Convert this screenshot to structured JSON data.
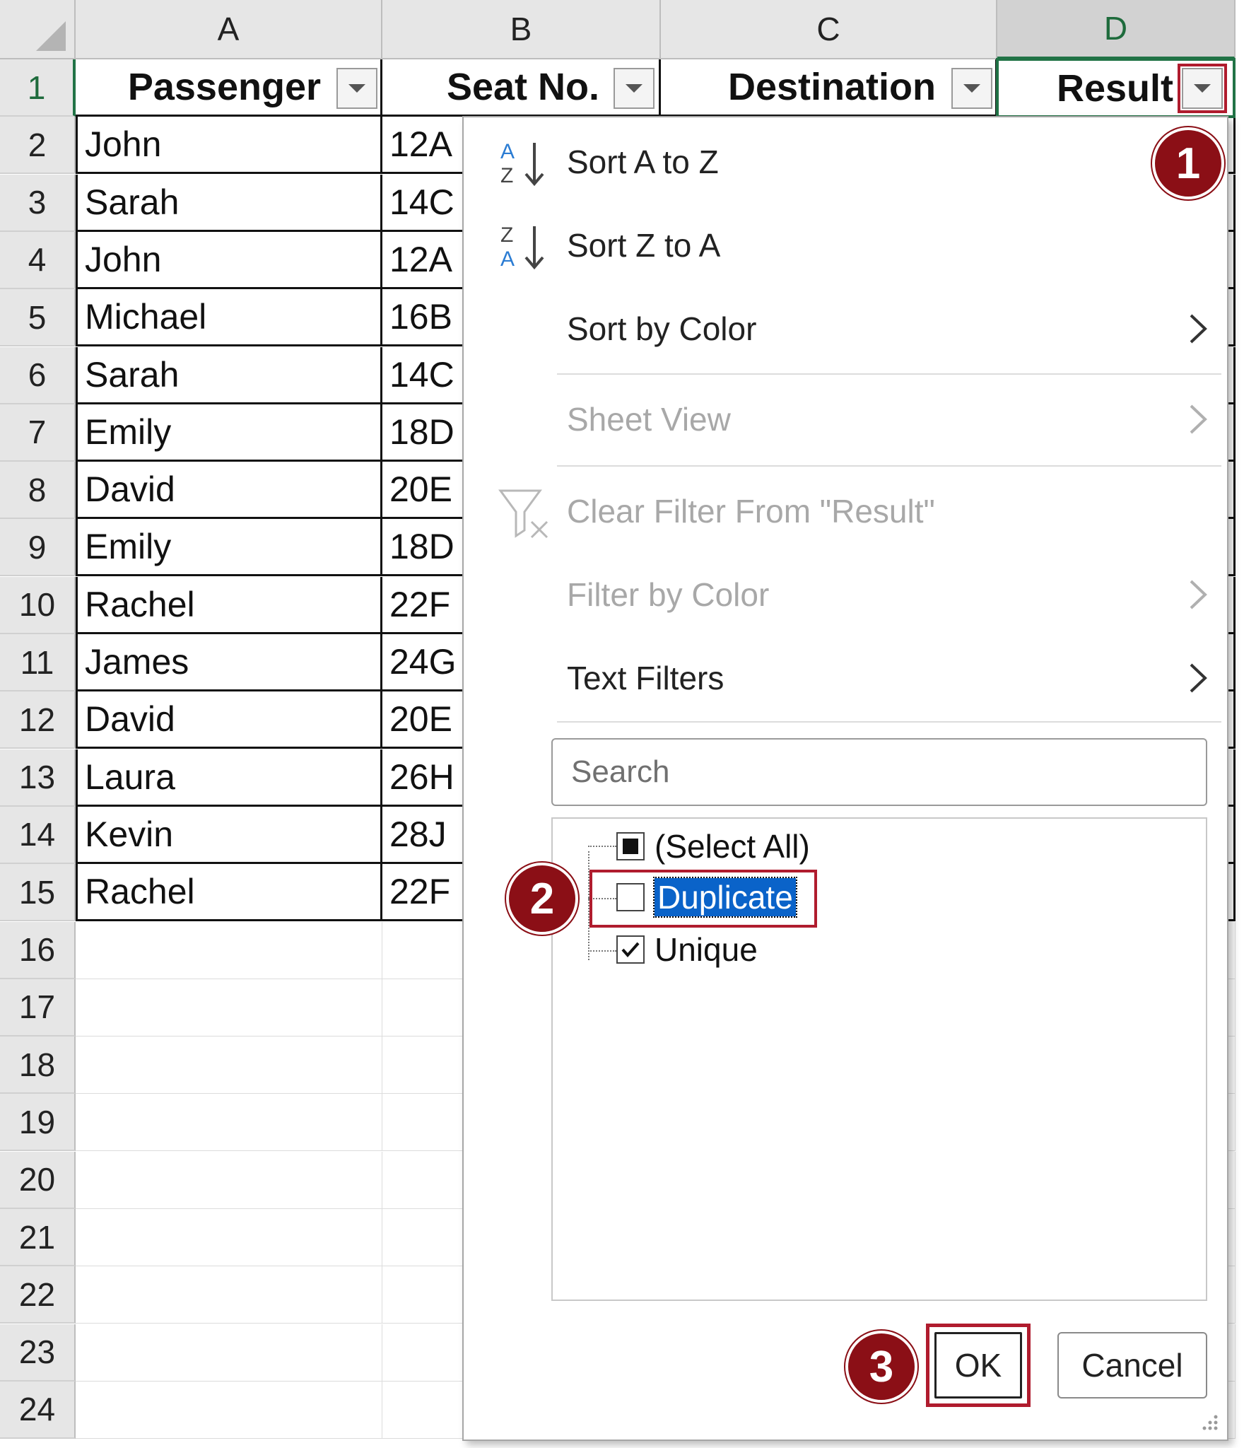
{
  "columns": [
    "A",
    "B",
    "C",
    "D"
  ],
  "row_numbers": [
    "1",
    "2",
    "3",
    "4",
    "5",
    "6",
    "7",
    "8",
    "9",
    "10",
    "11",
    "12",
    "13",
    "14",
    "15",
    "16",
    "17",
    "18",
    "19",
    "20",
    "21",
    "22",
    "23",
    "24"
  ],
  "headers": {
    "passenger": "Passenger",
    "seat": "Seat No.",
    "destination": "Destination",
    "result": "Result"
  },
  "rows": [
    {
      "passenger": "John",
      "seat": "12A"
    },
    {
      "passenger": "Sarah",
      "seat": "14C"
    },
    {
      "passenger": "John",
      "seat": "12A"
    },
    {
      "passenger": "Michael",
      "seat": "16B"
    },
    {
      "passenger": "Sarah",
      "seat": "14C"
    },
    {
      "passenger": "Emily",
      "seat": "18D"
    },
    {
      "passenger": "David",
      "seat": "20E"
    },
    {
      "passenger": "Emily",
      "seat": "18D"
    },
    {
      "passenger": "Rachel",
      "seat": "22F"
    },
    {
      "passenger": "James",
      "seat": "24G"
    },
    {
      "passenger": "David",
      "seat": "20E"
    },
    {
      "passenger": "Laura",
      "seat": "26H"
    },
    {
      "passenger": "Kevin",
      "seat": "28J"
    },
    {
      "passenger": "Rachel",
      "seat": "22F"
    }
  ],
  "menu": {
    "sort_az": "Sort A to Z",
    "sort_za": "Sort Z to A",
    "sort_by_color": "Sort by Color",
    "sheet_view": "Sheet View",
    "clear_filter": "Clear Filter From \"Result\"",
    "filter_by_color": "Filter by Color",
    "text_filters": "Text Filters",
    "search_placeholder": "Search",
    "list": {
      "select_all": "(Select All)",
      "duplicate": "Duplicate",
      "unique": "Unique"
    },
    "ok": "OK",
    "cancel": "Cancel"
  },
  "callouts": {
    "one": "1",
    "two": "2",
    "three": "3"
  },
  "colors": {
    "accent_green": "#217346",
    "callout_red": "#8b0f16",
    "highlight_red": "#b01c2e",
    "selection_blue": "#0a63c9"
  }
}
